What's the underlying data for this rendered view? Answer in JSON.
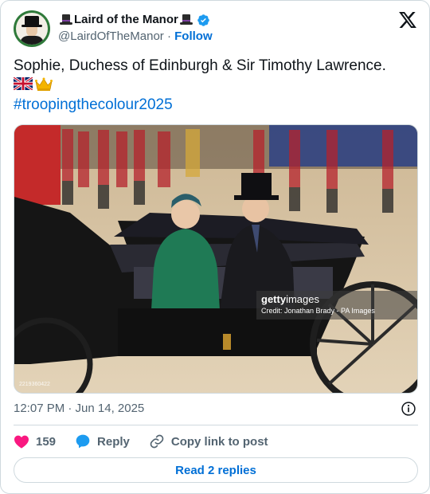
{
  "author": {
    "display_name": "Laird of the Manor",
    "handle": "@LairdOfTheManor",
    "separator": "·",
    "follow_label": "Follow"
  },
  "tweet": {
    "text": "Sophie, Duchess of Edinburgh & Sir Timothy Lawrence.",
    "emojis": [
      "uk-flag",
      "crown"
    ],
    "hashtag": "#troopingthecolour2025"
  },
  "media": {
    "watermark_brand_bold": "getty",
    "watermark_brand_light": "images",
    "credit": "Credit: Jonathan Brady - PA Images",
    "image_id": "2219360422"
  },
  "meta": {
    "timestamp": "12:07 PM · Jun 14, 2025"
  },
  "actions": {
    "like_count": "159",
    "reply_label": "Reply",
    "copy_label": "Copy link to post"
  },
  "footer": {
    "replies_label": "Read 2 replies"
  },
  "colors": {
    "link_blue": "#006fd6",
    "like_red": "#f91880",
    "verified_blue": "#1d9bf0",
    "secondary_text": "#536471",
    "border": "#cfd9de"
  }
}
